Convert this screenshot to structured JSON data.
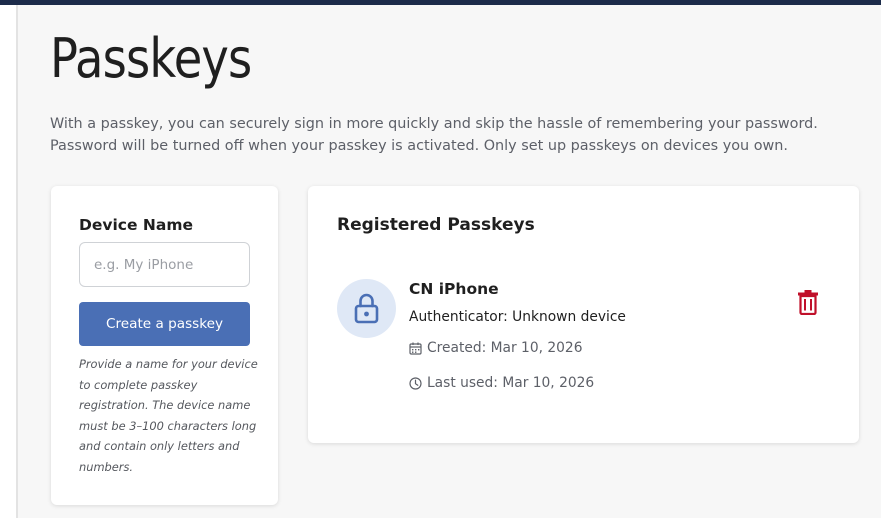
{
  "page": {
    "title": "Passkeys",
    "intro": "With a passkey, you can securely sign in more quickly and skip the hassle of remembering your password. Password will be turned off when your passkey is activated. Only set up passkeys on devices you own."
  },
  "create_form": {
    "label": "Device Name",
    "input_value": "",
    "input_placeholder": "e.g. My iPhone",
    "button_label": "Create a passkey",
    "help_text": "Provide a name for your device to complete passkey registration. The device name must be 3–100 characters long and contain only letters and numbers."
  },
  "registered": {
    "title": "Registered Passkeys",
    "items": [
      {
        "name": "CN iPhone",
        "authenticator": "Authenticator: Unknown device",
        "created": "Created: Mar 10, 2026",
        "last_used": "Last used: Mar 10, 2026",
        "icon": "lock-icon"
      }
    ]
  },
  "colors": {
    "accent": "#4a6fb5",
    "danger": "#c0102a",
    "topbar": "#1c2b4a",
    "icon_circle": "#dfe8f6"
  }
}
